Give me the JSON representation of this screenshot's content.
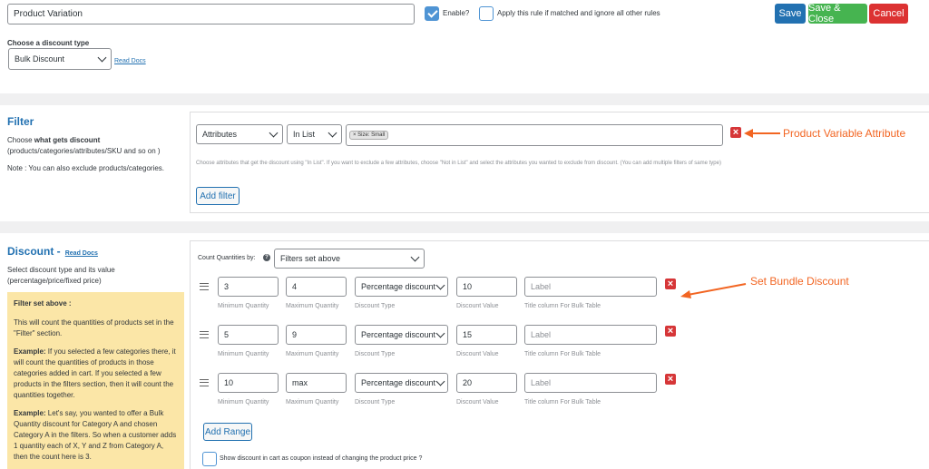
{
  "header": {
    "rule_name": "Product Variation",
    "enable_label": "Enable?",
    "enable_checked": true,
    "exclusive_label": "Apply this rule if matched and ignore all other rules",
    "exclusive_checked": false,
    "save_label": "Save",
    "save_close_label": "Save & Close",
    "cancel_label": "Cancel"
  },
  "discount_type": {
    "heading": "Choose a discount type",
    "value": "Bulk Discount",
    "read_docs": "Read Docs"
  },
  "filter": {
    "title": "Filter",
    "desc_prefix": "Choose ",
    "desc_bold": "what gets discount",
    "desc_rest": "(products/categories/attributes/SKU and so on )",
    "note": "Note : You can also exclude products/categories.",
    "type_value": "Attributes",
    "method_value": "In List",
    "tag_value": "× Size: Small",
    "hint": "Choose attributes that get the discount using \"In List\". If you want to exclude a few attributes, choose \"Not in List\" and select the attributes you wanted to exclude from discount. (You can add multiple filters of same type)",
    "add_filter_label": "Add filter",
    "annotation": "Product Variable Attribute"
  },
  "discount": {
    "title": "Discount -",
    "read_docs": "Read Docs",
    "desc": "Select discount type and its value (percentage/price/fixed price)",
    "count_label": "Count Quantities by:",
    "count_value": "Filters set above",
    "help": {
      "title": "Filter set above :",
      "p1": "This will count the quantities of products set in the \"Filter\" section.",
      "p2_bold": "Example:",
      "p2": " If you selected a few categories there, it will count the quantities of products in those categories added in cart. If you selected a few products in the filters section, then it will count the quantities together.",
      "p3_bold": "Example:",
      "p3": " Let's say, you wanted to offer a Bulk Quantity discount for Category A and chosen Category A in the filters. So when a customer adds 1 quantity each of X, Y and Z from Category A, then the count here is 3."
    },
    "field_labels": {
      "min": "Minimum Quantity",
      "max": "Maximum Quantity",
      "type": "Discount Type",
      "value": "Discount Value",
      "title": "Title column For Bulk Table"
    },
    "ranges": [
      {
        "min": "3",
        "max": "4",
        "type": "Percentage discount",
        "value": "10",
        "label_placeholder": "Label"
      },
      {
        "min": "5",
        "max": "9",
        "type": "Percentage discount",
        "value": "15",
        "label_placeholder": "Label"
      },
      {
        "min": "10",
        "max": "max",
        "type": "Percentage discount",
        "value": "20",
        "label_placeholder": "Label"
      }
    ],
    "add_range_label": "Add Range",
    "coupon_label": "Show discount in cart as coupon instead of changing the product price ?",
    "annotation": "Set Bundle Discount"
  },
  "colors": {
    "accent": "#2271b1",
    "save": "#2271b1",
    "save_close": "#46b450",
    "cancel": "#dc3232",
    "delete": "#d63638",
    "annotation": "#f26522",
    "help_bg": "#fbe6a7"
  }
}
